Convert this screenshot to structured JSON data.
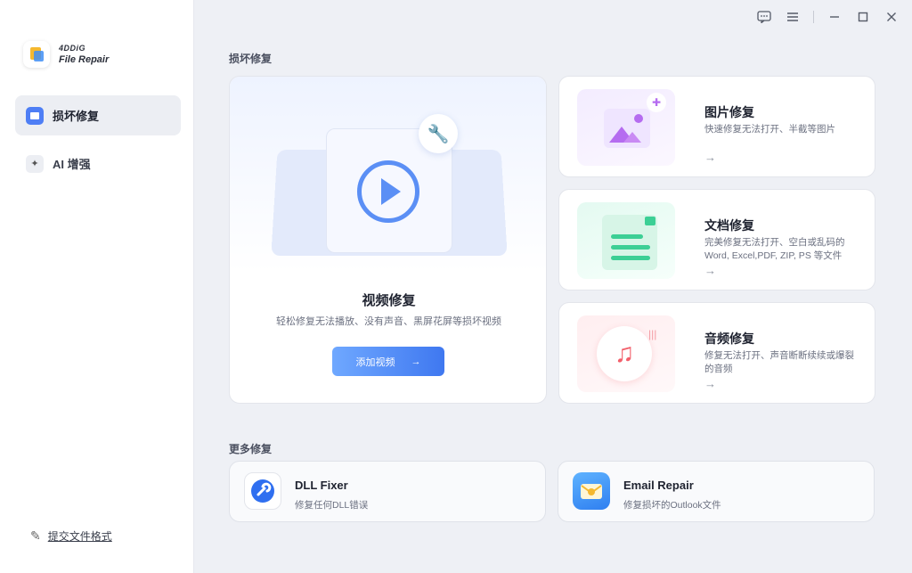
{
  "app": {
    "brand": "4DDiG",
    "product": "File Repair"
  },
  "sidebar": {
    "items": [
      {
        "label": "损坏修复",
        "active": true
      },
      {
        "label": "AI 增强",
        "active": false
      }
    ],
    "submit_format_label": "提交文件格式"
  },
  "window_controls": [
    "feedback-icon",
    "menu-icon",
    "minimize-icon",
    "maximize-icon",
    "close-icon"
  ],
  "main": {
    "repair_section_title": "损坏修复",
    "video": {
      "title": "视频修复",
      "description": "轻松修复无法播放、没有声音、黑屏花屏等损坏视频",
      "button_label": "添加视频",
      "button_arrow": "→"
    },
    "photo": {
      "title": "图片修复",
      "description": "快速修复无法打开、半截等图片",
      "arrow": "→"
    },
    "document": {
      "title": "文档修复",
      "description": "完美修复无法打开、空白或乱码的Word, Excel,PDF, ZIP, PS 等文件",
      "arrow": "→"
    },
    "audio": {
      "title": "音频修复",
      "description": "修复无法打开、声音断断续续或爆裂的音频",
      "arrow": "→"
    },
    "more_section_title": "更多修复",
    "more": [
      {
        "title": "DLL Fixer",
        "description": "修复任何DLL错误",
        "icon": "dll-fixer-icon",
        "color": "#2f6ff0"
      },
      {
        "title": "Email Repair",
        "description": "修复损坏的Outlook文件",
        "icon": "email-repair-icon",
        "color": "#3f9cf5"
      }
    ]
  },
  "colors": {
    "accent": "#4e7ef5",
    "button_start": "#6fa8ff",
    "button_end": "#3f78f0",
    "photo": "#b56cf0",
    "document": "#3ccf95",
    "audio": "#f25f6b"
  }
}
